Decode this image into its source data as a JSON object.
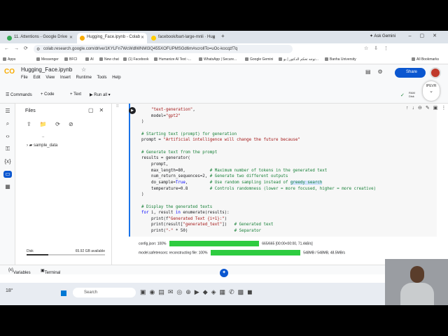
{
  "browser": {
    "tabs": [
      {
        "label": "11. Attentions - Google Drive",
        "active": false,
        "color": "#34a853"
      },
      {
        "label": "Hugging_Face.ipynb - Colab",
        "active": true,
        "color": "#f9ab00"
      },
      {
        "label": "facebook/bart-large-mnli · Hug",
        "active": false,
        "color": "#ffcc00"
      }
    ],
    "ask_gemini": "Ask Gemini",
    "url": "colab.research.google.com/drive/1KYLFn7WcWdlWNMI3Q455XOFUPMSGd6m#scrollTo=uOc-kocqzf7q",
    "bookmarks": [
      "Apps",
      "Messenger",
      "BFCI",
      "AI",
      "New chat",
      "(1) Facebook",
      "Humanize AI Text -...",
      "WhatsApp | Secure...",
      "Google Gemini",
      "توجه تحكم الدكتور | بو...",
      "Banha University",
      "All Bookmarks"
    ]
  },
  "colab": {
    "notebook_title": "Hugging_Face.ipynb",
    "menu": [
      "File",
      "Edit",
      "View",
      "Insert",
      "Runtime",
      "Tools",
      "Help"
    ],
    "share_label": "Share",
    "toolbar": {
      "commands": "Commands",
      "code": "+ Code",
      "text": "+ Text",
      "run_all": "Run all",
      "ram": "RAM",
      "disk": "Disk"
    },
    "fab_label": "IPEVR",
    "files_panel": {
      "title": "Files",
      "items": [
        {
          "name": ".."
        },
        {
          "name": "sample_data"
        }
      ],
      "disk_label": "Disk",
      "disk_value": "65.92 GB available",
      "disk_used_fraction": 0.28
    },
    "code_lines": [
      "    \"text-generation\",",
      "    model=\"gpt2\"",
      ")",
      "",
      "# Starting text (prompt) for generation",
      "prompt = \"Artificial intelligence will change the future because\"",
      "",
      "# Generate text from the prompt",
      "results = generator(",
      "    prompt,",
      "    max_length=80,          # Maximum number of tokens in the generated text",
      "    num_return_sequences=2, # Generate two different outputs",
      "    do_sample=True,         # Use random sampling instead of greedy search",
      "    temperature=0.8         # Controls randomness (lower = more focused, higher = more creative)",
      ")",
      "",
      "# Display the generated texts",
      "for i, result in enumerate(results):",
      "    print(f\"Generated Text {i+1}:\")",
      "    print(result[\"generated_text\"])   # Generated text",
      "    print(\"-\" * 50)                   # Separator"
    ],
    "outputs": [
      {
        "file": "config.json:",
        "pct": "100%",
        "progress": 1.0,
        "stats": "665/665 [00:00<00:00, 71.4kB/s]"
      },
      {
        "file": "model.safetensors:",
        "pct": "reconstructing file: 100%",
        "progress": 1.0,
        "stats": "548MB / 548MB, 48.5MB/s"
      }
    ],
    "dock": {
      "variables": "Variables",
      "terminal": "Terminal"
    }
  },
  "taskbar": {
    "weather": "18°",
    "search_placeholder": "Search"
  },
  "colors": {
    "colab_blue": "#0b57d0",
    "progress_green": "#2ecc40",
    "colab_orange": "#f9ab00"
  }
}
